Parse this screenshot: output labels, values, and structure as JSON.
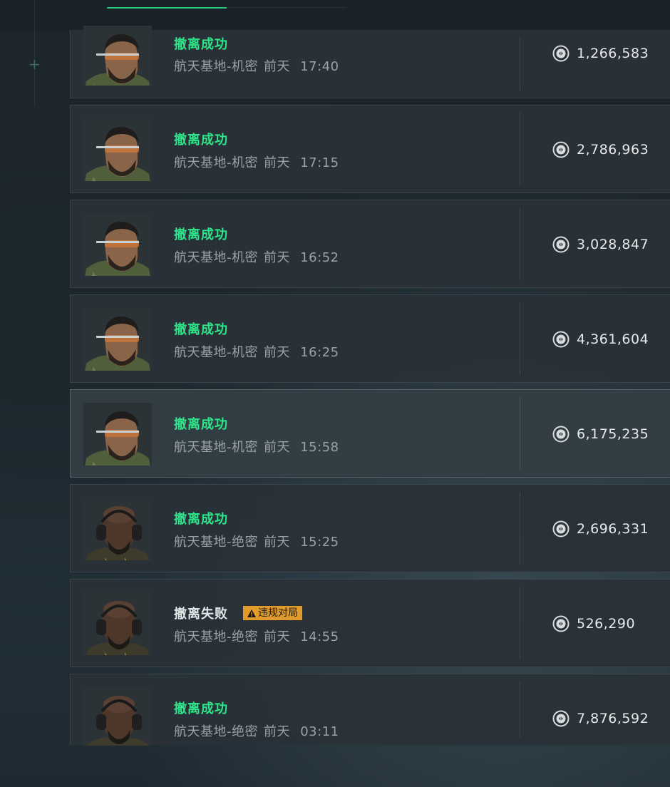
{
  "records": [
    {
      "status": "撤离成功",
      "result": "success",
      "map": "航天基地-机密",
      "day": "前天",
      "time": "17:40",
      "value": "1,266,583",
      "operator": "glasses-operator-avatar"
    },
    {
      "status": "撤离成功",
      "result": "success",
      "map": "航天基地-机密",
      "day": "前天",
      "time": "17:15",
      "value": "2,786,963",
      "operator": "glasses-operator-avatar"
    },
    {
      "status": "撤离成功",
      "result": "success",
      "map": "航天基地-机密",
      "day": "前天",
      "time": "16:52",
      "value": "3,028,847",
      "operator": "glasses-operator-avatar"
    },
    {
      "status": "撤离成功",
      "result": "success",
      "map": "航天基地-机密",
      "day": "前天",
      "time": "16:25",
      "value": "4,361,604",
      "operator": "glasses-operator-avatar"
    },
    {
      "status": "撤离成功",
      "result": "success",
      "map": "航天基地-机密",
      "day": "前天",
      "time": "15:58",
      "value": "6,175,235",
      "operator": "glasses-operator-avatar"
    },
    {
      "status": "撤离成功",
      "result": "success",
      "map": "航天基地-绝密",
      "day": "前天",
      "time": "15:25",
      "value": "2,696,331",
      "operator": "headset-operator-avatar"
    },
    {
      "status": "撤离失败",
      "result": "fail",
      "badge": "违规对局",
      "map": "航天基地-绝密",
      "day": "前天",
      "time": "14:55",
      "value": "526,290",
      "operator": "headset-operator-avatar"
    },
    {
      "status": "撤离成功",
      "result": "success",
      "map": "航天基地-绝密",
      "day": "前天",
      "time": "03:11",
      "value": "7,876,592",
      "operator": "headset-operator-avatar"
    }
  ],
  "colors": {
    "success": "#2ee58a",
    "fail": "#e4e7e8",
    "badge": "#e19a2c",
    "accent_tab": "#27c47d"
  },
  "icons": {
    "currency": "coin-icon",
    "warning": "warning-triangle-icon"
  }
}
